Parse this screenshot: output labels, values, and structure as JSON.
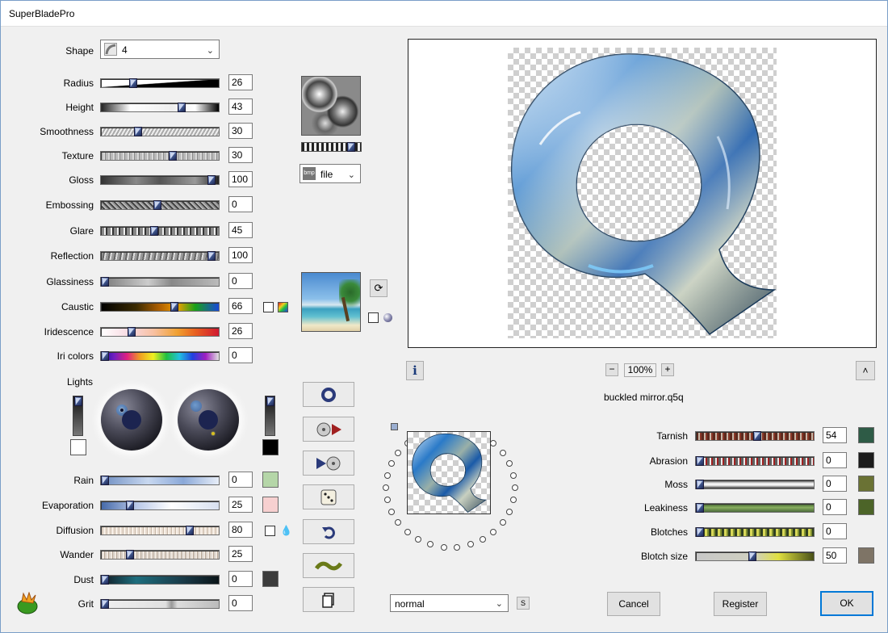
{
  "window": {
    "title": "SuperBladePro"
  },
  "shape": {
    "label": "Shape",
    "value": "4"
  },
  "sliders": [
    {
      "key": "radius",
      "label": "Radius",
      "value": "26",
      "fraction": 0.26
    },
    {
      "key": "height",
      "label": "Height",
      "value": "43",
      "fraction": 0.7
    },
    {
      "key": "smoothness",
      "label": "Smoothness",
      "value": "30",
      "fraction": 0.3
    },
    {
      "key": "texture",
      "label": "Texture",
      "value": "30",
      "fraction": 0.62
    },
    {
      "key": "gloss",
      "label": "Gloss",
      "value": "100",
      "fraction": 0.97
    },
    {
      "key": "embossing",
      "label": "Embossing",
      "value": "0",
      "fraction": 0.48
    },
    {
      "key": "glare",
      "label": "Glare",
      "value": "45",
      "fraction": 0.45
    },
    {
      "key": "reflection",
      "label": "Reflection",
      "value": "100",
      "fraction": 0.97
    },
    {
      "key": "glassiness",
      "label": "Glassiness",
      "value": "0",
      "fraction": 0.0
    },
    {
      "key": "caustic",
      "label": "Caustic",
      "value": "66",
      "fraction": 0.63
    },
    {
      "key": "iridescence",
      "label": "Iridescence",
      "value": "26",
      "fraction": 0.24
    },
    {
      "key": "iricolors",
      "label": "Iri colors",
      "value": "0",
      "fraction": 0.0
    }
  ],
  "texture_source": {
    "value": "file",
    "icon": "bmp"
  },
  "lights": {
    "label": "Lights"
  },
  "weather": [
    {
      "key": "rain",
      "label": "Rain",
      "value": "0",
      "fraction": 0.0,
      "color": "#b5d6a8"
    },
    {
      "key": "evaporation",
      "label": "Evaporation",
      "value": "25",
      "fraction": 0.23,
      "color": "#f7d0d0"
    },
    {
      "key": "diffusion",
      "label": "Diffusion",
      "value": "80",
      "fraction": 0.77
    },
    {
      "key": "wander",
      "label": "Wander",
      "value": "25",
      "fraction": 0.23
    },
    {
      "key": "dust",
      "label": "Dust",
      "value": "0",
      "fraction": 0.0,
      "color": "#3c3c3c"
    },
    {
      "key": "grit",
      "label": "Grit",
      "value": "0",
      "fraction": 0.0
    }
  ],
  "aging": [
    {
      "key": "tarnish",
      "label": "Tarnish",
      "value": "54",
      "fraction": 0.52,
      "color": "#2e5b46"
    },
    {
      "key": "abrasion",
      "label": "Abrasion",
      "value": "0",
      "fraction": 0.0,
      "color": "#1c1c1c"
    },
    {
      "key": "moss",
      "label": "Moss",
      "value": "0",
      "fraction": 0.0,
      "color": "#6a7234"
    },
    {
      "key": "leakiness",
      "label": "Leakiness",
      "value": "0",
      "fraction": 0.0,
      "color": "#4c6428"
    },
    {
      "key": "blotches",
      "label": "Blotches",
      "value": "0",
      "fraction": 0.0
    },
    {
      "key": "blotchsize",
      "label": "Blotch size",
      "value": "50",
      "fraction": 0.48,
      "color": "#7e7466"
    }
  ],
  "preview": {
    "zoom": "100%",
    "filename": "buckled mirror.q5q",
    "letter": "q"
  },
  "blend": {
    "value": "normal"
  },
  "buttons": {
    "cancel": "Cancel",
    "register": "Register",
    "ok": "OK",
    "s": "S"
  }
}
